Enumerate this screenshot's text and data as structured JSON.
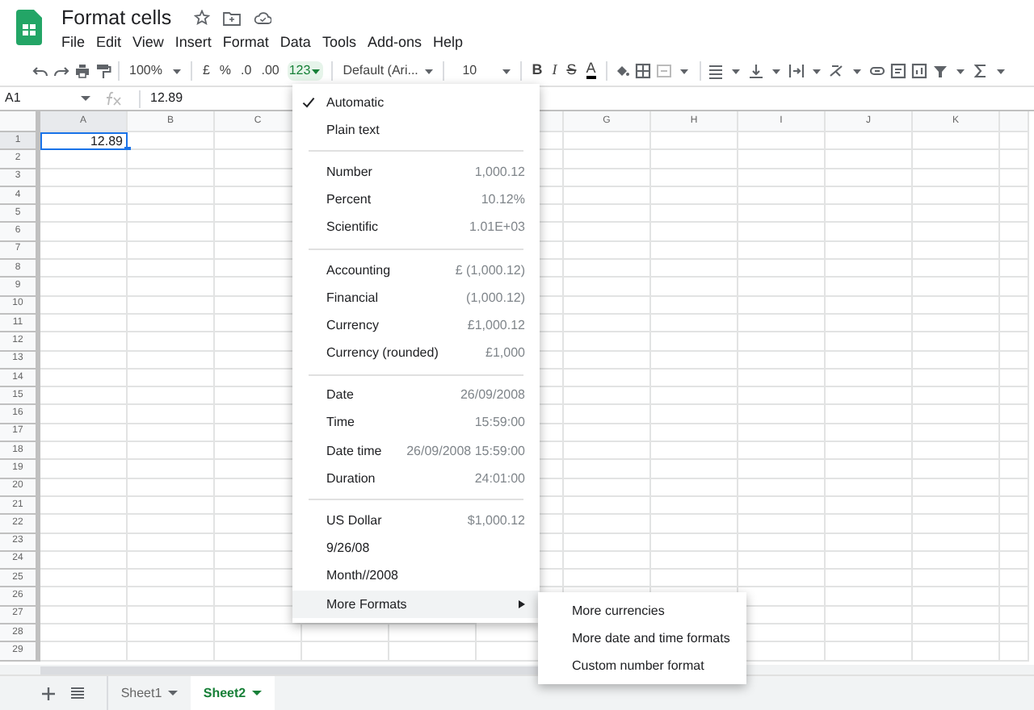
{
  "document": {
    "title": "Format cells"
  },
  "menu_bar": [
    "File",
    "Edit",
    "View",
    "Insert",
    "Format",
    "Data",
    "Tools",
    "Add-ons",
    "Help"
  ],
  "toolbar": {
    "zoom": "100%",
    "currency": "£",
    "percent": "%",
    "decrease_decimal": ".0",
    "increase_decimal": ".00",
    "more_formats": {
      "label": "123",
      "active": true
    },
    "font": "Default (Ari...",
    "font_size": "10",
    "bold": "B",
    "italic": "I",
    "strikethrough": "S",
    "text_color": "A"
  },
  "formula_bar": {
    "cell_ref": "A1",
    "value": "12.89"
  },
  "columns_left": [
    "A",
    "B",
    "C"
  ],
  "columns_right": [
    "G",
    "H",
    "I",
    "J",
    "K"
  ],
  "rows": [
    "1",
    "2",
    "3",
    "4",
    "5",
    "6",
    "7",
    "8",
    "9",
    "10",
    "11",
    "12",
    "13",
    "14",
    "15",
    "16",
    "17",
    "18",
    "19",
    "20",
    "21",
    "22",
    "23",
    "24",
    "25",
    "26",
    "27",
    "28",
    "29"
  ],
  "cell_a1": "12.89",
  "format_menu": [
    [
      {
        "label": "Automatic",
        "checked": true,
        "highlighted": false
      },
      {
        "label": "Plain text",
        "checked": false,
        "highlighted": false
      }
    ],
    [
      {
        "label": "Number",
        "example": "1,000.12",
        "checked": false,
        "highlighted": false
      },
      {
        "label": "Percent",
        "example": "10.12%",
        "checked": false,
        "highlighted": false
      },
      {
        "label": "Scientific",
        "example": "1.01E+03",
        "checked": false,
        "highlighted": false
      }
    ],
    [
      {
        "label": "Accounting",
        "example": "£ (1,000.12)",
        "checked": false,
        "highlighted": false
      },
      {
        "label": "Financial",
        "example": "(1,000.12)",
        "checked": false,
        "highlighted": false
      },
      {
        "label": "Currency",
        "example": "£1,000.12",
        "checked": false,
        "highlighted": false
      },
      {
        "label": "Currency (rounded)",
        "example": "£1,000",
        "checked": false,
        "highlighted": false
      }
    ],
    [
      {
        "label": "Date",
        "example": "26/09/2008",
        "checked": false,
        "highlighted": false
      },
      {
        "label": "Time",
        "example": "15:59:00",
        "checked": false,
        "highlighted": false
      },
      {
        "label": "Date time",
        "example": "26/09/2008 15:59:00",
        "checked": false,
        "highlighted": false
      },
      {
        "label": "Duration",
        "example": "24:01:00",
        "checked": false,
        "highlighted": false
      }
    ],
    [
      {
        "label": "US Dollar",
        "example": "$1,000.12",
        "checked": false,
        "highlighted": false
      },
      {
        "label": "9/26/08",
        "checked": false,
        "highlighted": false
      },
      {
        "label": "Month//2008",
        "checked": false,
        "highlighted": false
      },
      {
        "label": "More Formats",
        "checked": false,
        "highlighted": true,
        "has_submenu": true
      }
    ]
  ],
  "submenu": [
    "More currencies",
    "More date and time formats",
    "Custom number format"
  ],
  "sheet_tabs": [
    {
      "label": "Sheet1",
      "selected": false
    },
    {
      "label": "Sheet2",
      "selected": true
    }
  ]
}
